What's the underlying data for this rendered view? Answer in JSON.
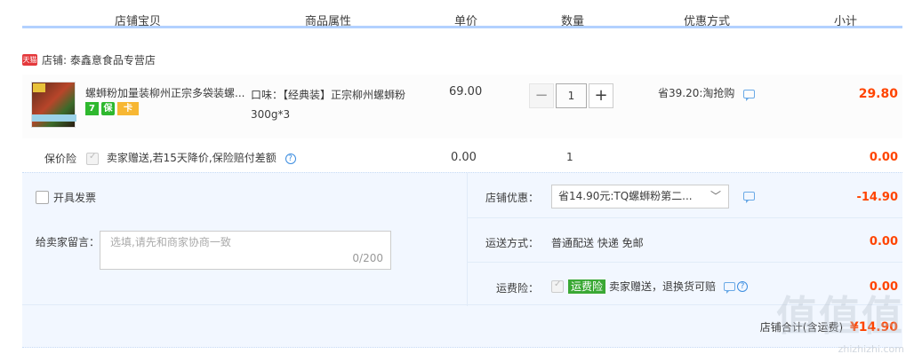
{
  "header": {
    "col_item": "店铺宝贝",
    "col_attr": "商品属性",
    "col_price": "单价",
    "col_qty": "数量",
    "col_promo": "优惠方式",
    "col_subtotal": "小计"
  },
  "shop": {
    "badge": "天猫",
    "name": "店铺: 泰鑫意食品专营店"
  },
  "item": {
    "title": "螺蛳粉加量装柳州正宗多袋装螺...",
    "badges": [
      "7",
      "保",
      "卡"
    ],
    "attr": "口味：【经典装】正宗柳州螺蛳粉300g*3",
    "price": "69.00",
    "qty": "1",
    "minus": "−",
    "plus": "+",
    "promo": "省39.20:淘抢购",
    "subtotal": "29.80"
  },
  "insurance": {
    "label": "保价险",
    "desc": "卖家赠送,若15天降价,保险赔付差额",
    "help": "?",
    "price": "0.00",
    "qty": "1",
    "total": "0.00"
  },
  "invoice": {
    "label": "开具发票"
  },
  "message": {
    "label": "给卖家留言：",
    "placeholder": "选填,请先和商家协商一致",
    "count": "0/200"
  },
  "shop_discount": {
    "label": "店铺优惠：",
    "selected": "省14.90元:TQ螺蛳粉第二...",
    "chevron": "﹀",
    "amount": "-14.90"
  },
  "shipping": {
    "label": "运送方式：",
    "value": "普通配送 快递 免邮",
    "amount": "0.00"
  },
  "freight_insurance": {
    "label": "运费险：",
    "tag": "运费险",
    "desc": "卖家赠送，退换货可赔",
    "help": "?",
    "amount": "0.00"
  },
  "shop_total": {
    "label": "店铺合计(含运费)",
    "amount": "¥14.90"
  },
  "watermark": {
    "text": "zhizhizhi.com",
    "big": "值值值"
  },
  "colors": {
    "accent_red": "#ff4400",
    "header_line": "#b2d1ff",
    "panel_bg": "#f2f7ff",
    "tag_green": "#3aa834"
  }
}
